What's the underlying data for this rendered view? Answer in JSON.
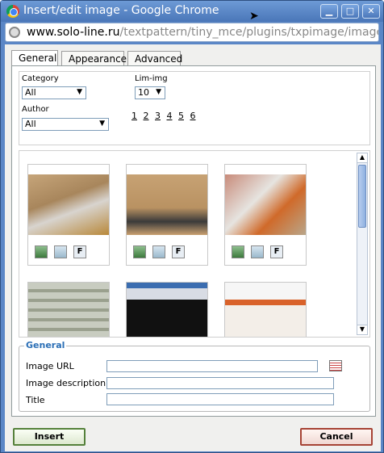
{
  "window": {
    "title": "Insert/edit image - Google Chrome",
    "url_host": "www.solo-line.ru",
    "url_path": "/textpattern/tiny_mce/plugins/txpimage/image.htm"
  },
  "tabs": [
    "General",
    "Appearance",
    "Advanced"
  ],
  "filters": {
    "category_label": "Category",
    "category_value": "All",
    "limit_label": "Lim-img",
    "limit_value": "10",
    "author_label": "Author",
    "author_value": "All",
    "pages": [
      "1",
      "2",
      "3",
      "4",
      "5",
      "6"
    ]
  },
  "gallery": {
    "tool_labels": [
      "",
      "",
      "F"
    ]
  },
  "general": {
    "legend": "General",
    "image_url_label": "Image URL",
    "image_description_label": "Image description",
    "title_label": "Title",
    "image_url_value": "",
    "image_description_value": "",
    "title_value": ""
  },
  "buttons": {
    "insert": "Insert",
    "cancel": "Cancel"
  },
  "colors": {
    "titlebar": "#5a86c6",
    "legend": "#2b6fb6",
    "insert_border": "#55813b",
    "cancel_border": "#a64335"
  }
}
